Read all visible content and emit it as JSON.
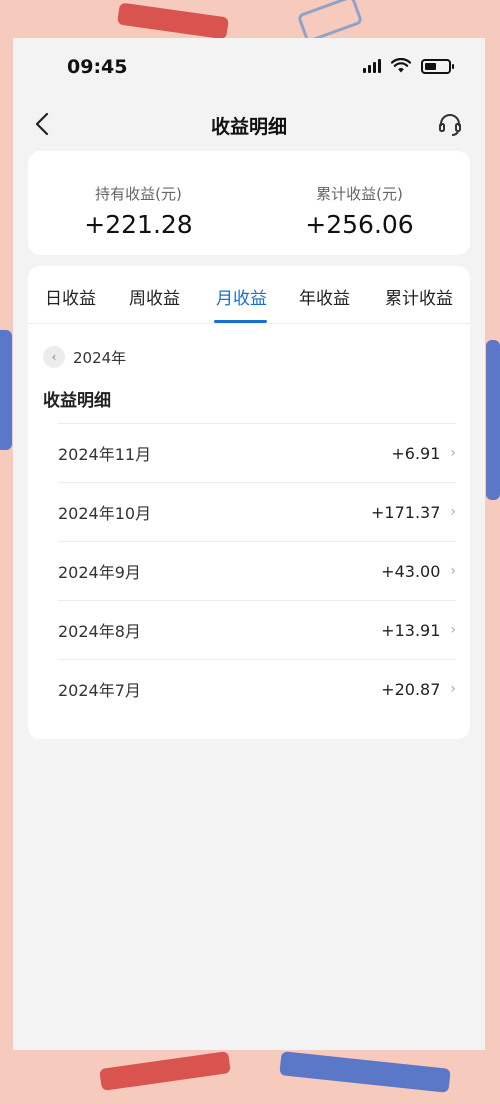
{
  "status_bar": {
    "time": "09:45"
  },
  "navbar": {
    "title": "收益明细"
  },
  "summary": {
    "holding_label": "持有收益(元)",
    "holding_value": "+221.28",
    "total_label": "累计收益(元)",
    "total_value": "+256.06"
  },
  "tabs": [
    {
      "label": "日收益"
    },
    {
      "label": "周收益"
    },
    {
      "label": "月收益",
      "active": true
    },
    {
      "label": "年收益"
    },
    {
      "label": "累计收益"
    }
  ],
  "year_selector": {
    "year": "2024年"
  },
  "detail": {
    "title": "收益明细",
    "rows": [
      {
        "month": "2024年11月",
        "amount": "+6.91"
      },
      {
        "month": "2024年10月",
        "amount": "+171.37"
      },
      {
        "month": "2024年9月",
        "amount": "+43.00"
      },
      {
        "month": "2024年8月",
        "amount": "+13.91"
      },
      {
        "month": "2024年7月",
        "amount": "+20.87"
      }
    ]
  },
  "colors": {
    "accent": "#1b6fd1",
    "background": "#f3f3f3",
    "frame": "#f6cbbd"
  }
}
